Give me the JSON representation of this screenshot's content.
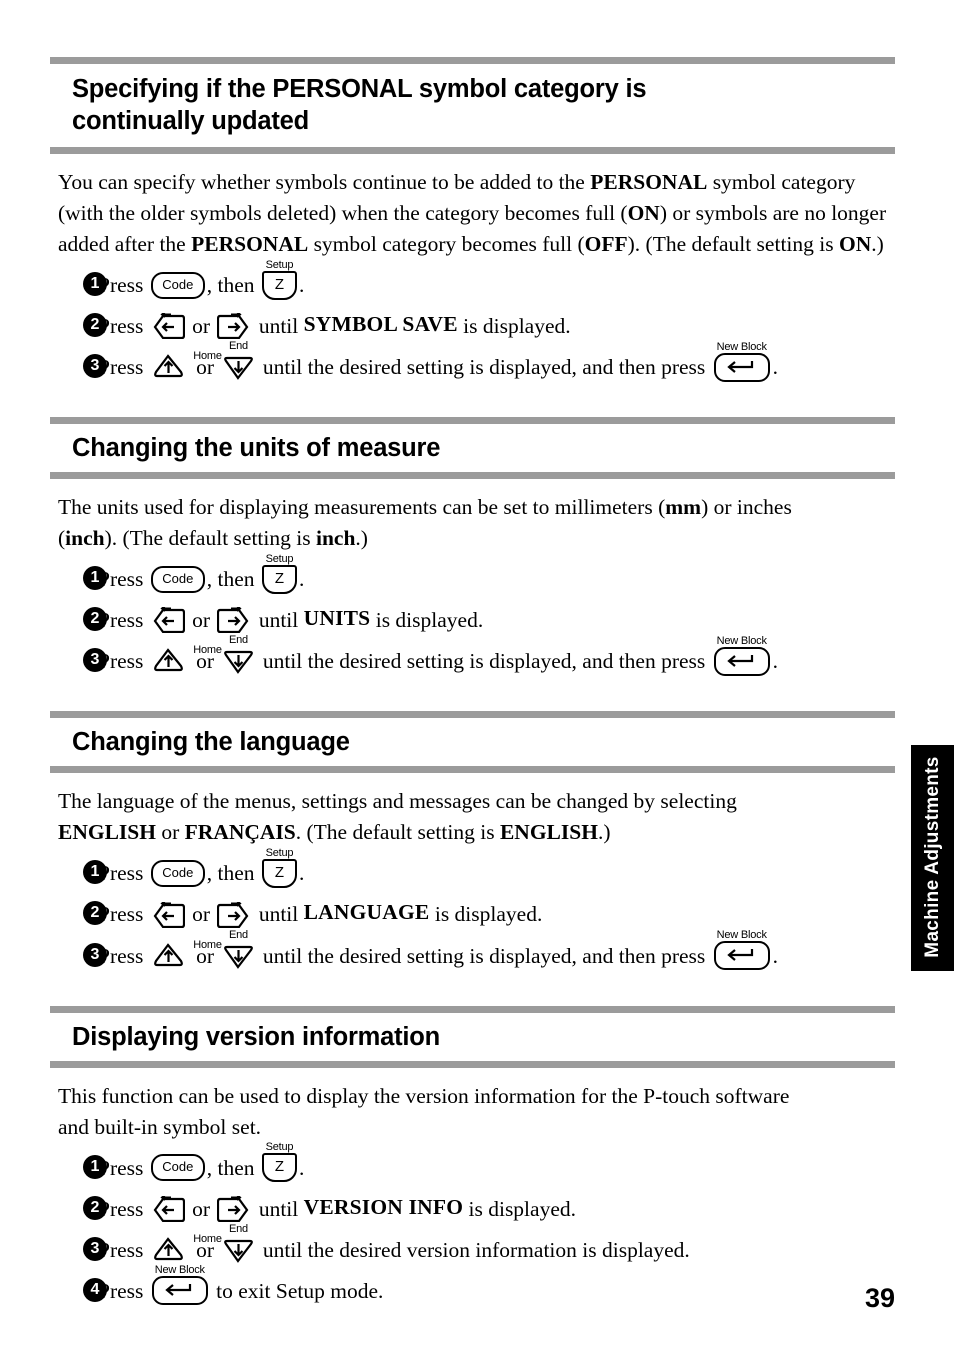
{
  "page": {
    "number": "39",
    "side_tab": "Machine Adjustments",
    "accent_gray": "#9b9b9b",
    "tab_background": "#000000"
  },
  "keys": {
    "code": {
      "label": "Code",
      "cap": ""
    },
    "setup": {
      "label": "Z",
      "cap": "Setup"
    },
    "new_block": {
      "label": "",
      "cap": "New Block",
      "icon": "enter-arrow-icon"
    },
    "left": {
      "label": "",
      "cap": "",
      "icon": "left-arrow-key-icon"
    },
    "right": {
      "label": "",
      "cap": "",
      "icon": "right-arrow-key-icon"
    },
    "up": {
      "label": "",
      "cap": "Home",
      "icon": "up-arrow-key-icon"
    },
    "down": {
      "label": "",
      "cap": "End",
      "icon": "down-arrow-key-icon"
    }
  },
  "sections": [
    {
      "heading_line1": "Specifying if the PERSONAL symbol category is",
      "heading_line2": "continually updated",
      "body": {
        "p1a": "You can specify whether symbols continue to be added to the ",
        "b1": "PERSONAL",
        "p1b": " symbol category",
        "p2a": "(with the older symbols deleted) when the category becomes full (",
        "b2": "ON",
        "p2b": ") or symbols are no longer",
        "p3a": "added after the ",
        "b3": "PERSONAL",
        "p3b": " symbol category becomes full (",
        "b4": "OFF",
        "p3c": "). (The default setting is ",
        "b5": "ON",
        "p3d": ".)"
      },
      "steps": {
        "s1_a": "Press ",
        "s1_b": ", then ",
        "s1_c": ".",
        "s2_a": "Press ",
        "s2_b": " or ",
        "s2_c": " until ",
        "s2_target": "SYMBOL SAVE",
        "s2_d": " is displayed.",
        "s3_a": "Press ",
        "s3_b": " or ",
        "s3_c": " until the desired setting is displayed, and then press ",
        "s3_d": "."
      }
    },
    {
      "heading_line1": "Changing the units of measure",
      "body": {
        "p1a": "The units used for displaying measurements can be set to millimeters (",
        "b1": "mm",
        "p1b": ") or inches",
        "p2a": "(",
        "b2": "inch",
        "p2b": "). (The default setting is ",
        "b3": "inch",
        "p2c": ".)"
      },
      "steps": {
        "s1_a": "Press ",
        "s1_b": ", then ",
        "s1_c": ".",
        "s2_a": "Press ",
        "s2_b": " or ",
        "s2_c": " until ",
        "s2_target": "UNITS",
        "s2_d": " is displayed.",
        "s3_a": "Press ",
        "s3_b": " or ",
        "s3_c": " until the desired setting is displayed, and then press ",
        "s3_d": "."
      }
    },
    {
      "heading_line1": "Changing the language",
      "body": {
        "p1a": "The language of the menus, settings and messages can be changed by selecting",
        "b1": "ENGLISH",
        "p2a": " or ",
        "b2": "FRANÇAIS",
        "p2b": ". (The default setting is ",
        "b3": "ENGLISH",
        "p2c": ".)"
      },
      "steps": {
        "s1_a": "Press ",
        "s1_b": ", then ",
        "s1_c": ".",
        "s2_a": "Press ",
        "s2_b": " or ",
        "s2_c": " until ",
        "s2_target": "LANGUAGE",
        "s2_d": " is displayed.",
        "s3_a": "Press ",
        "s3_b": " or ",
        "s3_c": " until the desired setting is displayed, and then press ",
        "s3_d": "."
      }
    },
    {
      "heading_line1": "Displaying version information",
      "body": {
        "p1a": "This function can be used to display the version information for the P-touch software",
        "p2a": "and built-in symbol set."
      },
      "steps": {
        "s1_a": "Press ",
        "s1_b": ", then ",
        "s1_c": ".",
        "s2_a": "Press ",
        "s2_b": " or ",
        "s2_c": " until ",
        "s2_target": "VERSION INFO",
        "s2_d": " is displayed.",
        "s3_a": "Press ",
        "s3_b": " or ",
        "s3_c": " until the desired version information is displayed.",
        "s4_a": "Press ",
        "s4_b": " to exit Setup mode."
      }
    }
  ],
  "step_numbers": [
    "1",
    "2",
    "3",
    "4"
  ]
}
